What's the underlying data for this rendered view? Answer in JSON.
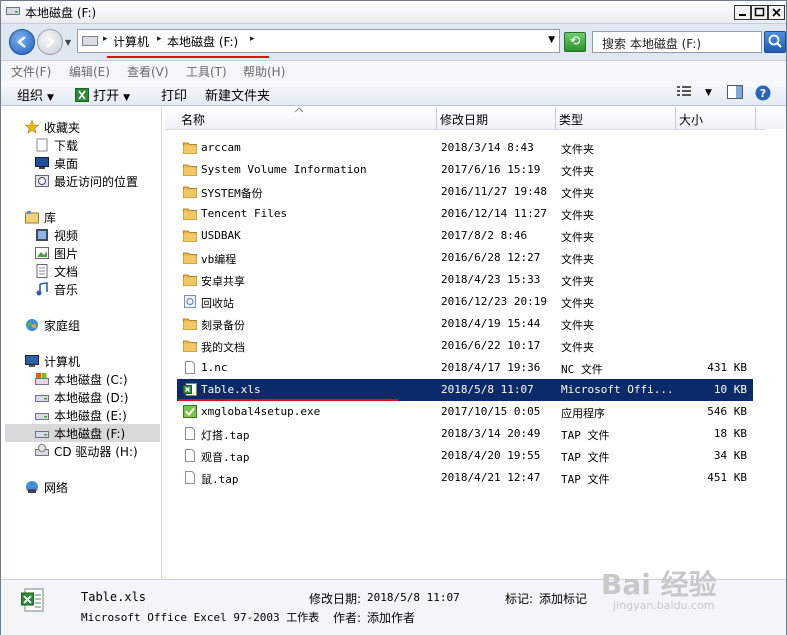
{
  "window": {
    "title": "本地磁盘 (F:)"
  },
  "address": {
    "crumbs": [
      "计算机",
      "本地磁盘 (F:)"
    ],
    "search_placeholder": "搜索 本地磁盘 (F:)"
  },
  "menu": [
    "文件(F)",
    "编辑(E)",
    "查看(V)",
    "工具(T)",
    "帮助(H)"
  ],
  "toolbar": {
    "organize": "组织",
    "open": "打开",
    "print": "打印",
    "new_folder": "新建文件夹"
  },
  "nav": {
    "favorites": "收藏夹",
    "fav_items": [
      "下载",
      "桌面",
      "最近访问的位置"
    ],
    "libraries": "库",
    "lib_items": [
      "视频",
      "图片",
      "文档",
      "音乐"
    ],
    "homegroup": "家庭组",
    "computer": "计算机",
    "drives": [
      "本地磁盘 (C:)",
      "本地磁盘 (D:)",
      "本地磁盘 (E:)",
      "本地磁盘 (F:)",
      "CD 驱动器 (H:)"
    ],
    "network": "网络"
  },
  "columns": [
    "名称",
    "修改日期",
    "类型",
    "大小"
  ],
  "files": [
    {
      "name": "arccam",
      "date": "2018/3/14 8:43",
      "type": "文件夹",
      "size": "",
      "icon": "folder-icon"
    },
    {
      "name": "System Volume Information",
      "date": "2017/6/16 15:19",
      "type": "文件夹",
      "size": "",
      "icon": "folder-icon"
    },
    {
      "name": "SYSTEM备份",
      "date": "2016/11/27 19:48",
      "type": "文件夹",
      "size": "",
      "icon": "folder-icon"
    },
    {
      "name": "Tencent Files",
      "date": "2016/12/14 11:27",
      "type": "文件夹",
      "size": "",
      "icon": "folder-icon"
    },
    {
      "name": "USDBAK",
      "date": "2017/8/2 8:46",
      "type": "文件夹",
      "size": "",
      "icon": "folder-icon"
    },
    {
      "name": "vb编程",
      "date": "2016/6/28 12:27",
      "type": "文件夹",
      "size": "",
      "icon": "folder-icon"
    },
    {
      "name": "安卓共享",
      "date": "2018/4/23 15:33",
      "type": "文件夹",
      "size": "",
      "icon": "folder-icon"
    },
    {
      "name": "回收站",
      "date": "2016/12/23 20:19",
      "type": "文件夹",
      "size": "",
      "icon": "recycle-icon"
    },
    {
      "name": "刻录备份",
      "date": "2018/4/19 15:44",
      "type": "文件夹",
      "size": "",
      "icon": "folder-icon"
    },
    {
      "name": "我的文档",
      "date": "2016/6/22 10:17",
      "type": "文件夹",
      "size": "",
      "icon": "folder-icon"
    },
    {
      "name": "1.nc",
      "date": "2018/4/17 19:36",
      "type": "NC 文件",
      "size": "431 KB",
      "icon": "file-icon"
    },
    {
      "name": "Table.xls",
      "date": "2018/5/8 11:07",
      "type": "Microsoft Offi...",
      "size": "10 KB",
      "icon": "excel-icon"
    },
    {
      "name": "xmglobal4setup.exe",
      "date": "2017/10/15 0:05",
      "type": "应用程序",
      "size": "546 KB",
      "icon": "exe-icon"
    },
    {
      "name": "灯搭.tap",
      "date": "2018/3/14 20:49",
      "type": "TAP 文件",
      "size": "18 KB",
      "icon": "file-icon"
    },
    {
      "name": "观音.tap",
      "date": "2018/4/20 19:55",
      "type": "TAP 文件",
      "size": "34 KB",
      "icon": "file-icon"
    },
    {
      "name": "鼠.tap",
      "date": "2018/4/21 12:47",
      "type": "TAP 文件",
      "size": "451 KB",
      "icon": "file-icon"
    }
  ],
  "selected_index": 11,
  "details": {
    "filename": "Table.xls",
    "filetype": "Microsoft Office Excel 97-2003 工作表",
    "modified_label": "修改日期:",
    "modified_value": "2018/5/8 11:07",
    "tags_label": "标记:",
    "tags_value": "添加标记",
    "author_label": "作者:",
    "author_value": "添加作者"
  },
  "watermark": {
    "text": "Bai 经验",
    "url": "jingyan.baidu.com"
  }
}
